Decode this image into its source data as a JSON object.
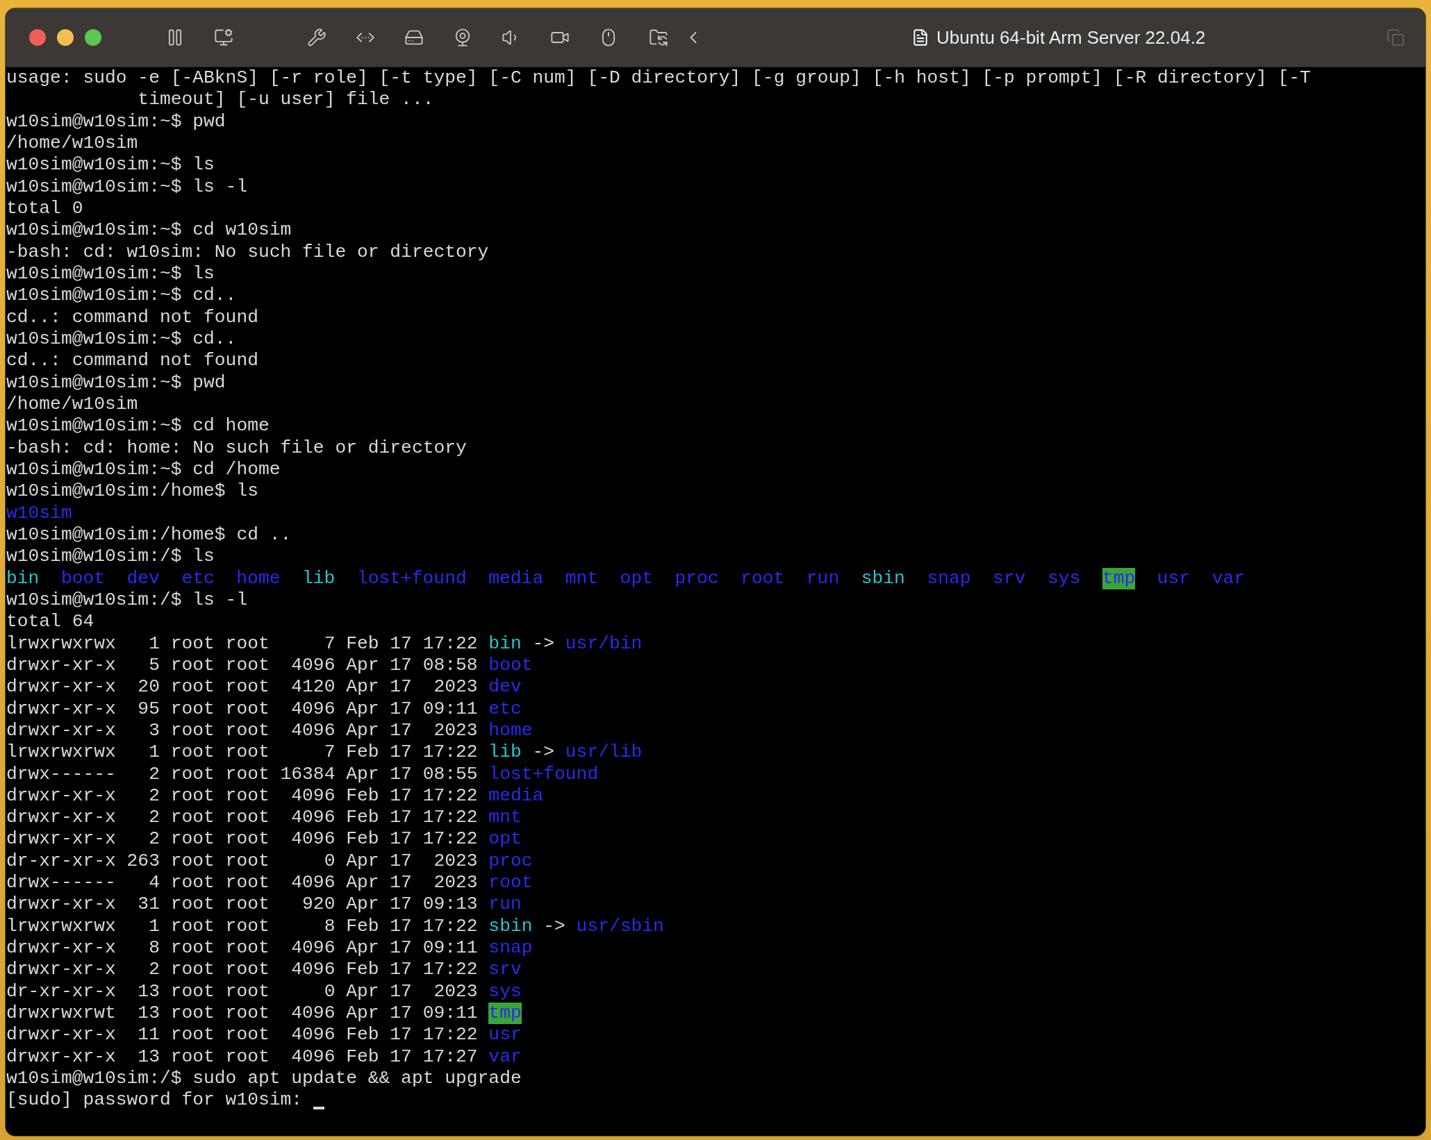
{
  "window": {
    "title": "Ubuntu 64-bit Arm Server 22.04.2"
  },
  "terminal": {
    "lines": [
      {
        "spans": [
          {
            "text": "usage: sudo -e [-ABknS] [-r role] [-t type] [-C num] [-D directory] [-g group] [-h host] [-p prompt] [-R directory] [-T",
            "kind": "plain"
          }
        ]
      },
      {
        "spans": [
          {
            "text": "            timeout] [-u user] file ...",
            "kind": "plain"
          }
        ]
      },
      {
        "spans": [
          {
            "text": "w10sim@w10sim:~$ pwd",
            "kind": "plain"
          }
        ]
      },
      {
        "spans": [
          {
            "text": "/home/w10sim",
            "kind": "plain"
          }
        ]
      },
      {
        "spans": [
          {
            "text": "w10sim@w10sim:~$ ls",
            "kind": "plain"
          }
        ]
      },
      {
        "spans": [
          {
            "text": "w10sim@w10sim:~$ ls -l",
            "kind": "plain"
          }
        ]
      },
      {
        "spans": [
          {
            "text": "total 0",
            "kind": "plain"
          }
        ]
      },
      {
        "spans": [
          {
            "text": "w10sim@w10sim:~$ cd w10sim",
            "kind": "plain"
          }
        ]
      },
      {
        "spans": [
          {
            "text": "-bash: cd: w10sim: No such file or directory",
            "kind": "plain"
          }
        ]
      },
      {
        "spans": [
          {
            "text": "w10sim@w10sim:~$ ls",
            "kind": "plain"
          }
        ]
      },
      {
        "spans": [
          {
            "text": "w10sim@w10sim:~$ cd..",
            "kind": "plain"
          }
        ]
      },
      {
        "spans": [
          {
            "text": "cd..: command not found",
            "kind": "plain"
          }
        ]
      },
      {
        "spans": [
          {
            "text": "w10sim@w10sim:~$ cd..",
            "kind": "plain"
          }
        ]
      },
      {
        "spans": [
          {
            "text": "cd..: command not found",
            "kind": "plain"
          }
        ]
      },
      {
        "spans": [
          {
            "text": "w10sim@w10sim:~$ pwd",
            "kind": "plain"
          }
        ]
      },
      {
        "spans": [
          {
            "text": "/home/w10sim",
            "kind": "plain"
          }
        ]
      },
      {
        "spans": [
          {
            "text": "w10sim@w10sim:~$ cd home",
            "kind": "plain"
          }
        ]
      },
      {
        "spans": [
          {
            "text": "-bash: cd: home: No such file or directory",
            "kind": "plain"
          }
        ]
      },
      {
        "spans": [
          {
            "text": "w10sim@w10sim:~$ cd /home",
            "kind": "plain"
          }
        ]
      },
      {
        "spans": [
          {
            "text": "w10sim@w10sim:/home$ ls",
            "kind": "plain"
          }
        ]
      },
      {
        "spans": [
          {
            "text": "w10sim",
            "kind": "dir"
          }
        ]
      },
      {
        "spans": [
          {
            "text": "w10sim@w10sim:/home$ cd ..",
            "kind": "plain"
          }
        ]
      },
      {
        "spans": [
          {
            "text": "w10sim@w10sim:/$ ls",
            "kind": "plain"
          }
        ]
      },
      {
        "entries": [
          {
            "text": "bin",
            "kind": "link"
          },
          {
            "text": "boot",
            "kind": "dir"
          },
          {
            "text": "dev",
            "kind": "dir"
          },
          {
            "text": "etc",
            "kind": "dir"
          },
          {
            "text": "home",
            "kind": "dir"
          },
          {
            "text": "lib",
            "kind": "link"
          },
          {
            "text": "lost+found",
            "kind": "dir"
          },
          {
            "text": "media",
            "kind": "dir"
          },
          {
            "text": "mnt",
            "kind": "dir"
          },
          {
            "text": "opt",
            "kind": "dir"
          },
          {
            "text": "proc",
            "kind": "dir"
          },
          {
            "text": "root",
            "kind": "dir"
          },
          {
            "text": "run",
            "kind": "dir"
          },
          {
            "text": "sbin",
            "kind": "link"
          },
          {
            "text": "snap",
            "kind": "dir"
          },
          {
            "text": "srv",
            "kind": "dir"
          },
          {
            "text": "sys",
            "kind": "dir"
          },
          {
            "text": "tmp",
            "kind": "sticky"
          },
          {
            "text": "usr",
            "kind": "dir"
          },
          {
            "text": "var",
            "kind": "dir"
          }
        ]
      },
      {
        "spans": [
          {
            "text": "w10sim@w10sim:/$ ls -l",
            "kind": "plain"
          }
        ]
      },
      {
        "spans": [
          {
            "text": "total 64",
            "kind": "plain"
          }
        ]
      },
      {
        "spans": [
          {
            "text": "lrwxrwxrwx   1 root root     7 Feb 17 17:22 ",
            "kind": "plain"
          },
          {
            "text": "bin",
            "kind": "link"
          },
          {
            "text": " -> ",
            "kind": "plain"
          },
          {
            "text": "usr/bin",
            "kind": "dir"
          }
        ]
      },
      {
        "spans": [
          {
            "text": "drwxr-xr-x   5 root root  4096 Apr 17 08:58 ",
            "kind": "plain"
          },
          {
            "text": "boot",
            "kind": "dir"
          }
        ]
      },
      {
        "spans": [
          {
            "text": "drwxr-xr-x  20 root root  4120 Apr 17  2023 ",
            "kind": "plain"
          },
          {
            "text": "dev",
            "kind": "dir"
          }
        ]
      },
      {
        "spans": [
          {
            "text": "drwxr-xr-x  95 root root  4096 Apr 17 09:11 ",
            "kind": "plain"
          },
          {
            "text": "etc",
            "kind": "dir"
          }
        ]
      },
      {
        "spans": [
          {
            "text": "drwxr-xr-x   3 root root  4096 Apr 17  2023 ",
            "kind": "plain"
          },
          {
            "text": "home",
            "kind": "dir"
          }
        ]
      },
      {
        "spans": [
          {
            "text": "lrwxrwxrwx   1 root root     7 Feb 17 17:22 ",
            "kind": "plain"
          },
          {
            "text": "lib",
            "kind": "link"
          },
          {
            "text": " -> ",
            "kind": "plain"
          },
          {
            "text": "usr/lib",
            "kind": "dir"
          }
        ]
      },
      {
        "spans": [
          {
            "text": "drwx------   2 root root 16384 Apr 17 08:55 ",
            "kind": "plain"
          },
          {
            "text": "lost+found",
            "kind": "dir"
          }
        ]
      },
      {
        "spans": [
          {
            "text": "drwxr-xr-x   2 root root  4096 Feb 17 17:22 ",
            "kind": "plain"
          },
          {
            "text": "media",
            "kind": "dir"
          }
        ]
      },
      {
        "spans": [
          {
            "text": "drwxr-xr-x   2 root root  4096 Feb 17 17:22 ",
            "kind": "plain"
          },
          {
            "text": "mnt",
            "kind": "dir"
          }
        ]
      },
      {
        "spans": [
          {
            "text": "drwxr-xr-x   2 root root  4096 Feb 17 17:22 ",
            "kind": "plain"
          },
          {
            "text": "opt",
            "kind": "dir"
          }
        ]
      },
      {
        "spans": [
          {
            "text": "dr-xr-xr-x 263 root root     0 Apr 17  2023 ",
            "kind": "plain"
          },
          {
            "text": "proc",
            "kind": "dir"
          }
        ]
      },
      {
        "spans": [
          {
            "text": "drwx------   4 root root  4096 Apr 17  2023 ",
            "kind": "plain"
          },
          {
            "text": "root",
            "kind": "dir"
          }
        ]
      },
      {
        "spans": [
          {
            "text": "drwxr-xr-x  31 root root   920 Apr 17 09:13 ",
            "kind": "plain"
          },
          {
            "text": "run",
            "kind": "dir"
          }
        ]
      },
      {
        "spans": [
          {
            "text": "lrwxrwxrwx   1 root root     8 Feb 17 17:22 ",
            "kind": "plain"
          },
          {
            "text": "sbin",
            "kind": "link"
          },
          {
            "text": " -> ",
            "kind": "plain"
          },
          {
            "text": "usr/sbin",
            "kind": "dir"
          }
        ]
      },
      {
        "spans": [
          {
            "text": "drwxr-xr-x   8 root root  4096 Apr 17 09:11 ",
            "kind": "plain"
          },
          {
            "text": "snap",
            "kind": "dir"
          }
        ]
      },
      {
        "spans": [
          {
            "text": "drwxr-xr-x   2 root root  4096 Feb 17 17:22 ",
            "kind": "plain"
          },
          {
            "text": "srv",
            "kind": "dir"
          }
        ]
      },
      {
        "spans": [
          {
            "text": "dr-xr-xr-x  13 root root     0 Apr 17  2023 ",
            "kind": "plain"
          },
          {
            "text": "sys",
            "kind": "dir"
          }
        ]
      },
      {
        "spans": [
          {
            "text": "drwxrwxrwt  13 root root  4096 Apr 17 09:11 ",
            "kind": "plain"
          },
          {
            "text": "tmp",
            "kind": "sticky"
          }
        ]
      },
      {
        "spans": [
          {
            "text": "drwxr-xr-x  11 root root  4096 Feb 17 17:22 ",
            "kind": "plain"
          },
          {
            "text": "usr",
            "kind": "dir"
          }
        ]
      },
      {
        "spans": [
          {
            "text": "drwxr-xr-x  13 root root  4096 Feb 17 17:27 ",
            "kind": "plain"
          },
          {
            "text": "var",
            "kind": "dir"
          }
        ]
      },
      {
        "spans": [
          {
            "text": "w10sim@w10sim:/$ sudo apt update && apt upgrade",
            "kind": "plain"
          }
        ]
      },
      {
        "spans": [
          {
            "text": "[sudo] password for w10sim: ",
            "kind": "plain"
          }
        ],
        "cursor": true
      }
    ]
  }
}
